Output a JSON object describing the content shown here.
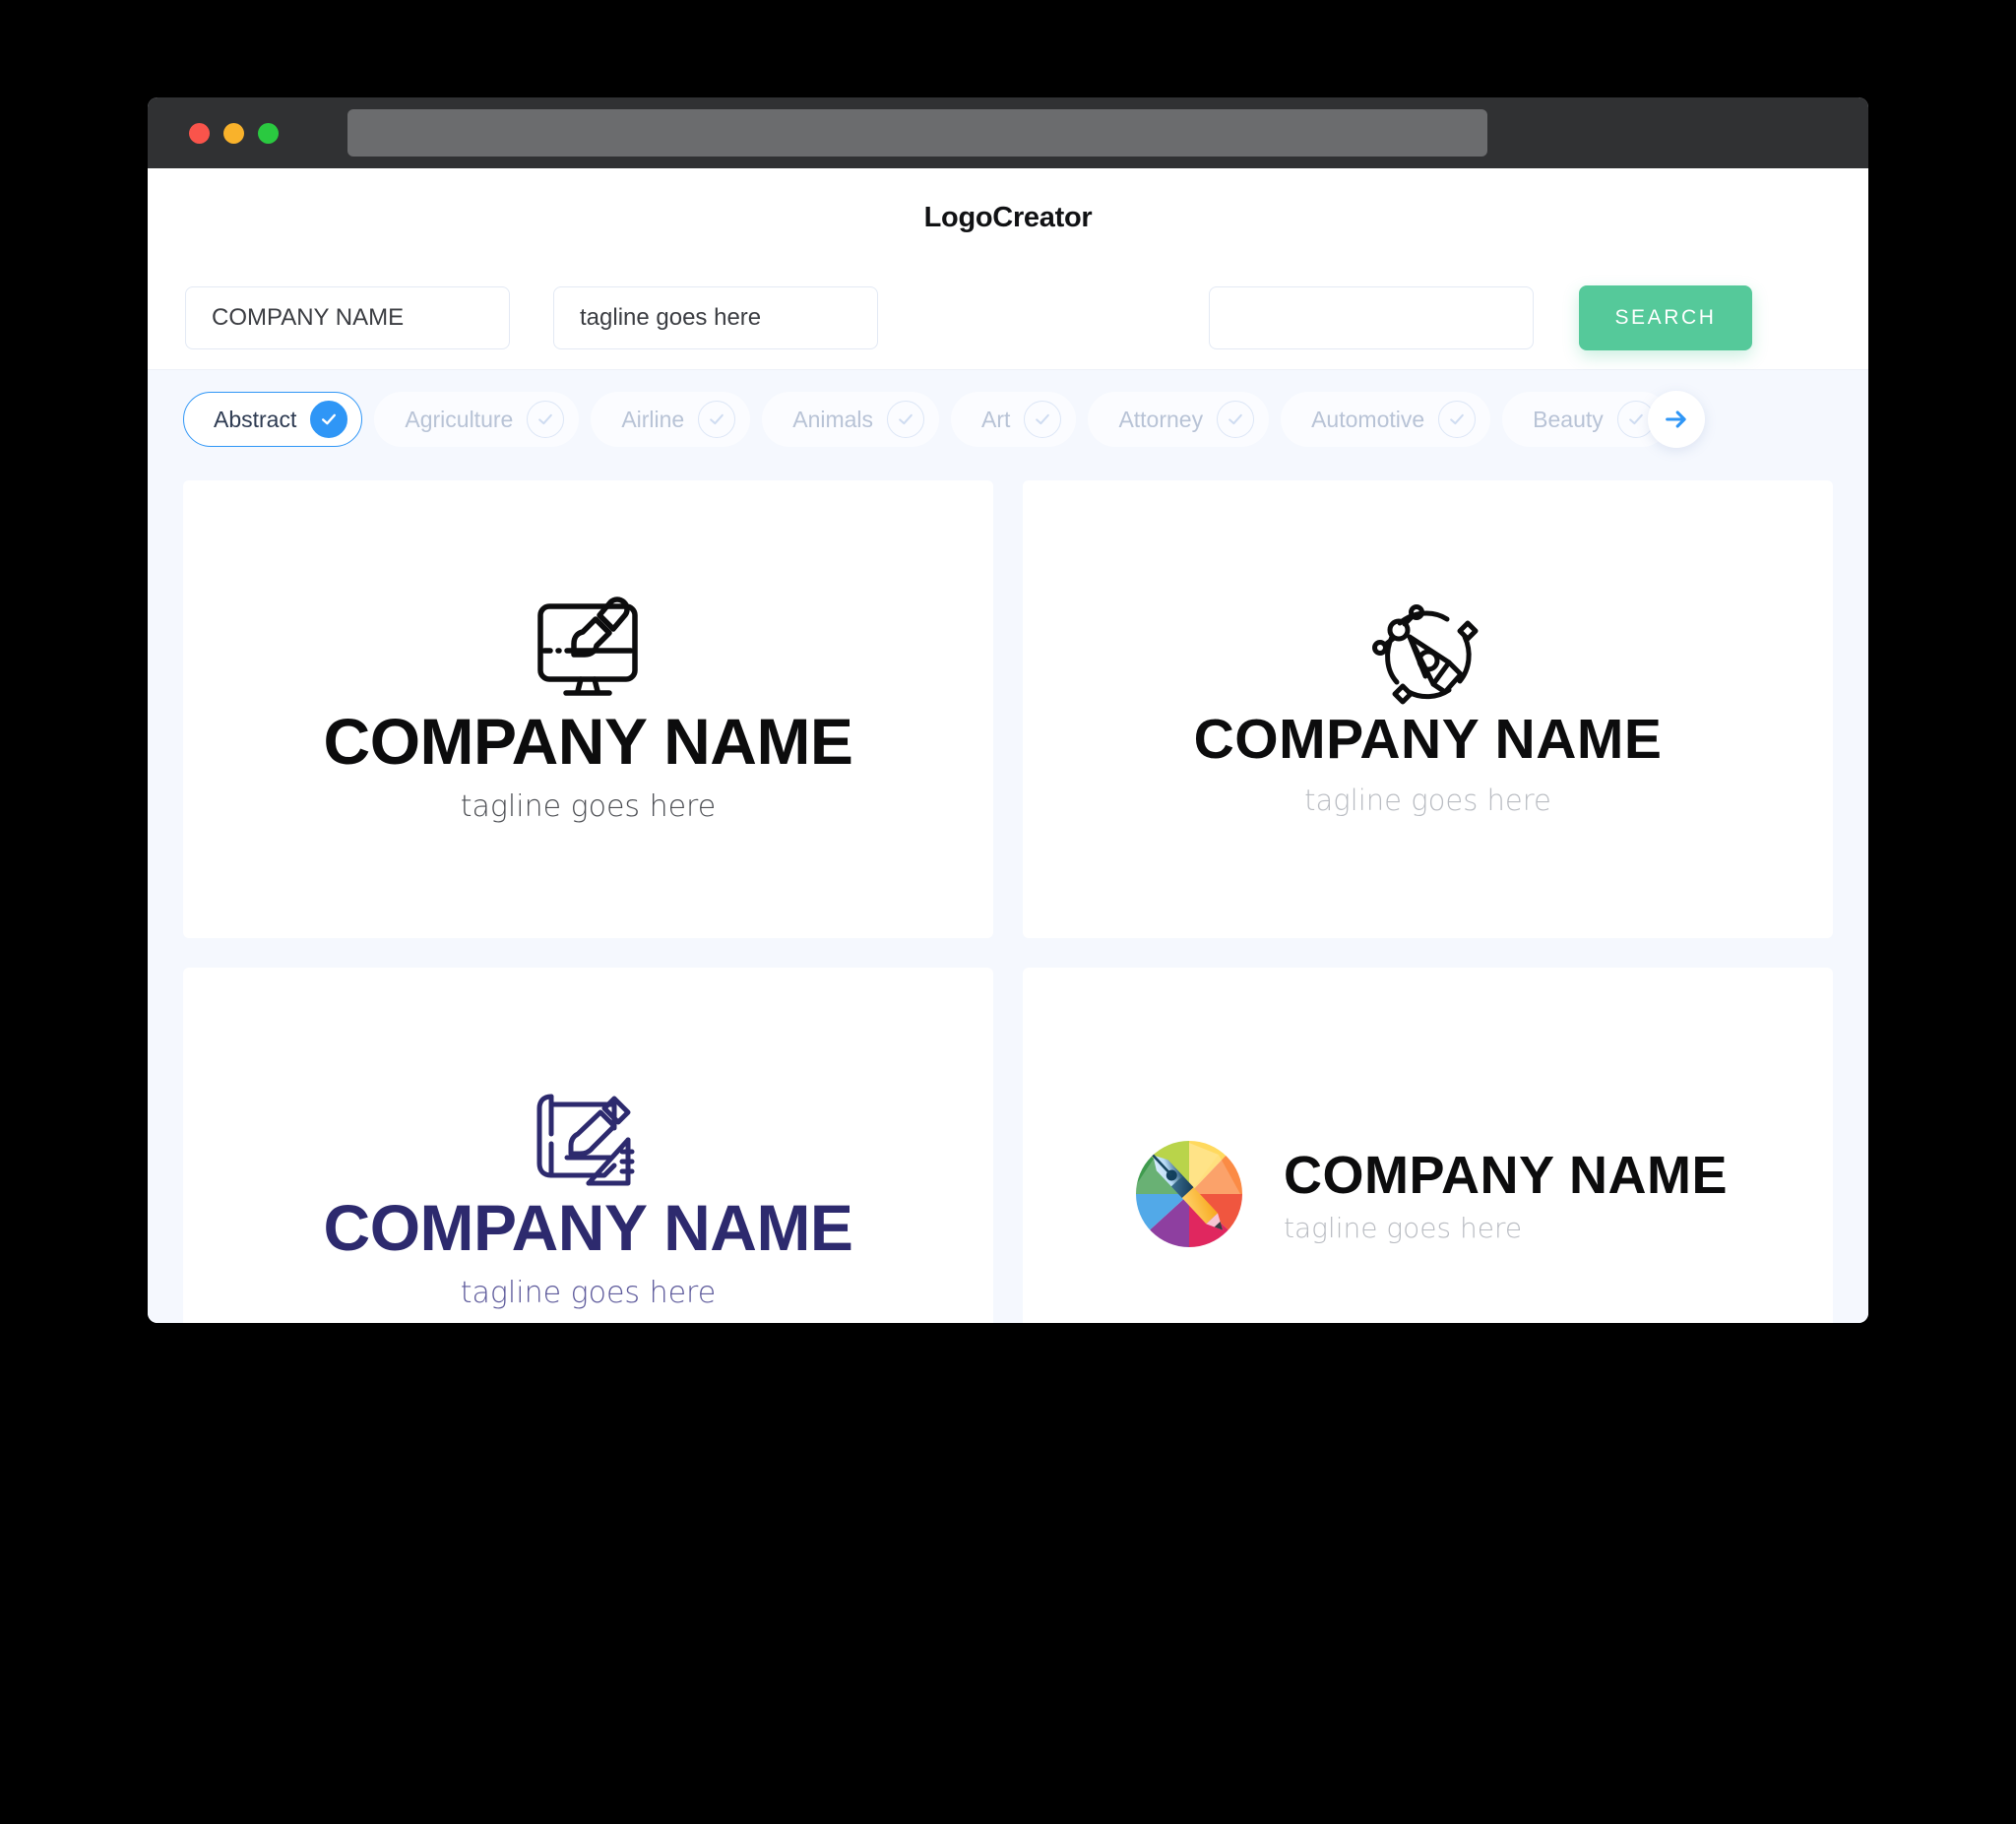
{
  "window": {
    "traffic_lights": [
      "close",
      "minimize",
      "maximize"
    ],
    "url_value": ""
  },
  "header": {
    "title": "LogoCreator"
  },
  "search": {
    "company_value": "COMPANY NAME",
    "company_placeholder": "COMPANY NAME",
    "tagline_value": "tagline goes here",
    "tagline_placeholder": "tagline goes here",
    "extra_value": "",
    "extra_placeholder": "",
    "button_label": "SEARCH",
    "button_color": "#55c99a"
  },
  "categories": {
    "accent_color": "#2f96f6",
    "items": [
      {
        "label": "Abstract",
        "selected": true
      },
      {
        "label": "Agriculture",
        "selected": false
      },
      {
        "label": "Airline",
        "selected": false
      },
      {
        "label": "Animals",
        "selected": false
      },
      {
        "label": "Art",
        "selected": false
      },
      {
        "label": "Attorney",
        "selected": false
      },
      {
        "label": "Automotive",
        "selected": false
      },
      {
        "label": "Beauty",
        "selected": false
      }
    ],
    "next_icon": "arrow-right-icon"
  },
  "results": {
    "cards": [
      {
        "icon": "monitor-paintbrush-icon",
        "name": "COMPANY NAME",
        "tagline": "tagline goes here",
        "name_color": "#0c0c0d",
        "tagline_color": "#4d4f54",
        "layout": "stacked"
      },
      {
        "icon": "pen-nib-vector-icon",
        "name": "COMPANY NAME",
        "tagline": "tagline goes here",
        "name_color": "#0c0c0d",
        "tagline_color": "#b9bcc2",
        "layout": "stacked"
      },
      {
        "icon": "blueprint-pencil-ruler-icon",
        "name": "COMPANY NAME",
        "tagline": "tagline goes here",
        "name_color": "#2d2a6e",
        "tagline_color": "#5d5a9b",
        "layout": "stacked"
      },
      {
        "icon": "color-wheel-pen-pencil-icon",
        "name": "COMPANY NAME",
        "tagline": "tagline goes here",
        "name_color": "#0c0c0d",
        "tagline_color": "#b9bcc2",
        "layout": "horizontal"
      }
    ]
  }
}
